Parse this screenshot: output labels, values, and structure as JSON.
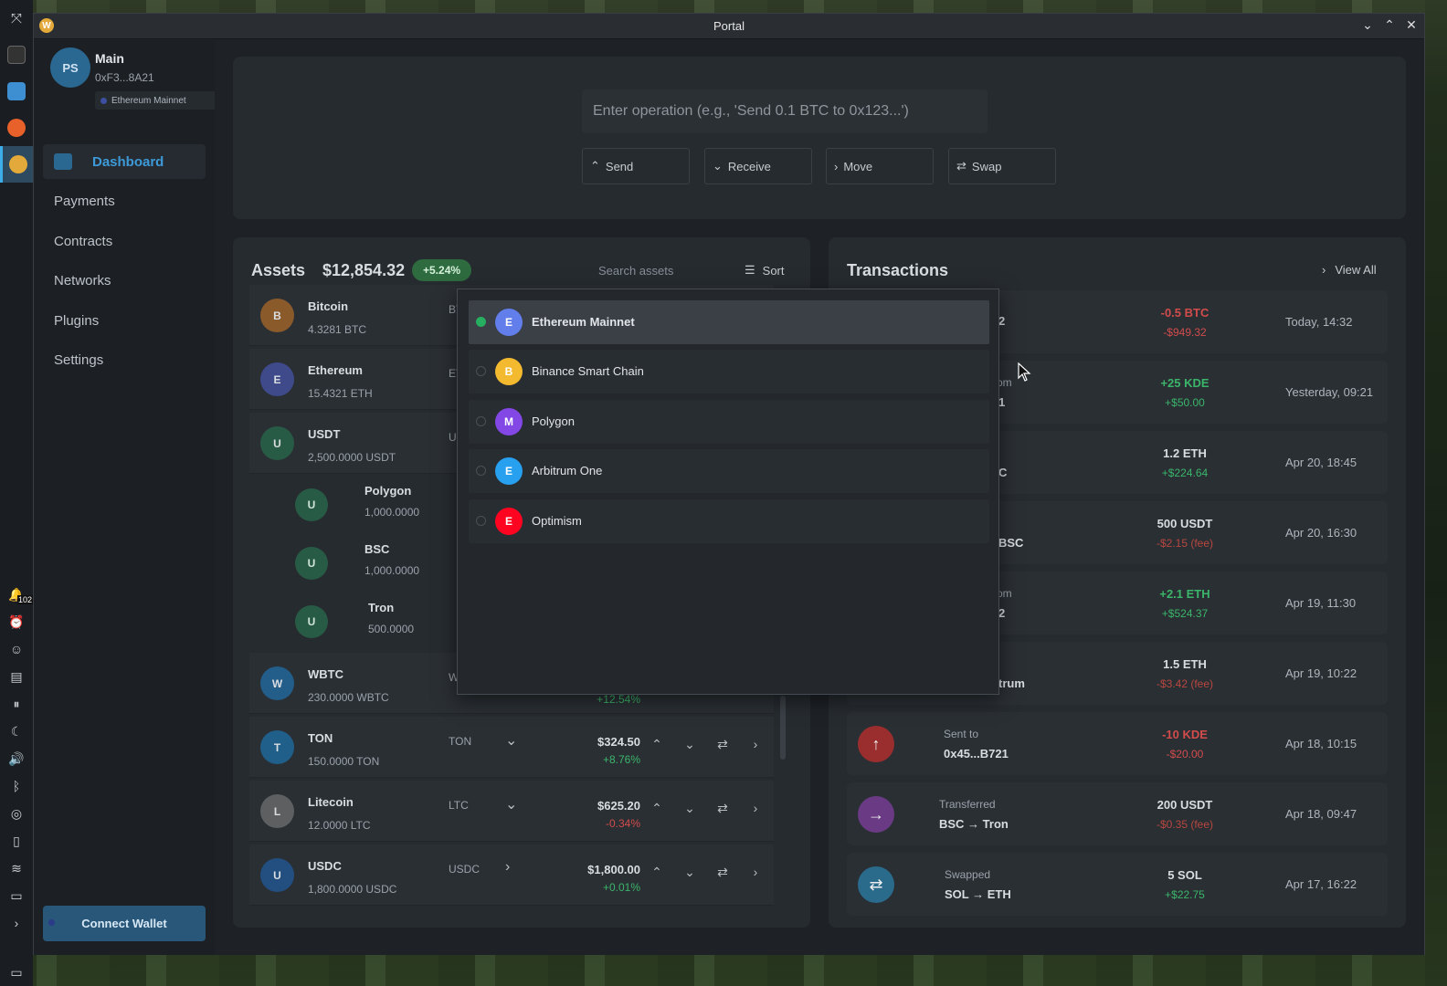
{
  "window": {
    "title": "Portal"
  },
  "profile": {
    "initials": "PS",
    "name": "Main",
    "address": "0xF3...8A21",
    "network": "Ethereum Mainnet"
  },
  "nav": {
    "items": [
      {
        "label": "Dashboard",
        "active": true
      },
      {
        "label": "Payments"
      },
      {
        "label": "Contracts"
      },
      {
        "label": "Networks"
      },
      {
        "label": "Plugins"
      },
      {
        "label": "Settings"
      }
    ]
  },
  "connect": {
    "label": "Connect Wallet"
  },
  "operation": {
    "placeholder": "Enter operation (e.g., 'Send 0.1 BTC to 0x123...')"
  },
  "actions": {
    "send": "Send",
    "receive": "Receive",
    "move": "Move",
    "swap": "Swap"
  },
  "assets": {
    "title": "Assets",
    "total": "$12,854.32",
    "change": "+5.24%",
    "search_placeholder": "Search assets",
    "sort_label": "Sort",
    "rows": [
      {
        "initial": "B",
        "name": "Bitcoin",
        "amount": "4.3281 BTC",
        "symbol": "BT",
        "color": "#8a5a2b"
      },
      {
        "initial": "E",
        "name": "Ethereum",
        "amount": "15.4321 ETH",
        "symbol": "ET",
        "color": "#3e4a8a"
      },
      {
        "initial": "U",
        "name": "USDT",
        "amount": "2,500.0000 USDT",
        "symbol": "U",
        "color": "#285b45"
      },
      {
        "initial": "W",
        "name": "WBTC",
        "amount": "230.0000 WBTC",
        "symbol": "W",
        "color": "#235d8a",
        "change": "+12.54%"
      },
      {
        "initial": "T",
        "name": "TON",
        "amount": "150.0000 TON",
        "symbol": "TON",
        "price": "$324.50",
        "change": "+8.76%",
        "color": "#1f5f8a"
      },
      {
        "initial": "L",
        "name": "Litecoin",
        "amount": "12.0000 LTC",
        "symbol": "LTC",
        "price": "$625.20",
        "change": "-0.34%",
        "color": "#5d5f61"
      },
      {
        "initial": "U",
        "name": "USDC",
        "amount": "1,800.0000 USDC",
        "symbol": "USDC",
        "price": "$1,800.00",
        "change": "+0.01%",
        "color": "#234e80"
      }
    ],
    "sub_rows": [
      {
        "initial": "U",
        "name": "Polygon",
        "amount": "1,000.0000"
      },
      {
        "initial": "U",
        "name": "BSC",
        "amount": "1,000.0000"
      },
      {
        "initial": "U",
        "name": "Tron",
        "amount": "500.0000"
      }
    ]
  },
  "transactions": {
    "title": "Transactions",
    "view_all": "View All",
    "items": [
      {
        "label": "",
        "who": "2",
        "amount": "-0.5 BTC",
        "usd": "-$949.32",
        "time": "Today, 14:32",
        "amount_tone": "neg",
        "usd_tone": "neg"
      },
      {
        "label": "om",
        "who": "1",
        "amount": "+25 KDE",
        "usd": "+$50.00",
        "time": "Yesterday, 09:21",
        "amount_tone": "pos",
        "usd_tone": "pos"
      },
      {
        "label": "",
        "who": "C",
        "amount": "1.2 ETH",
        "usd": "+$224.64",
        "time": "Apr 20, 18:45",
        "amount_tone": "neu",
        "usd_tone": "pos"
      },
      {
        "label": "",
        "who": "BSC",
        "amount": "500 USDT",
        "usd": "-$2.15 (fee)",
        "time": "Apr 20, 16:30",
        "amount_tone": "neu",
        "usd_tone": "neg"
      },
      {
        "label": "om",
        "who": "2",
        "amount": "+2.1 ETH",
        "usd": "+$524.37",
        "time": "Apr 19, 11:30",
        "amount_tone": "pos",
        "usd_tone": "pos"
      },
      {
        "label": "",
        "who": "trum",
        "amount": "1.5 ETH",
        "usd": "-$3.42 (fee)",
        "time": "Apr 19, 10:22",
        "amount_tone": "neu",
        "usd_tone": "neg"
      },
      {
        "label": "Sent to",
        "who": "0x45...B721",
        "amount": "-10 KDE",
        "usd": "-$20.00",
        "time": "Apr 18, 10:15",
        "amount_tone": "neg",
        "usd_tone": "neg",
        "icon": "↑",
        "icon_name": "arrow-up-icon",
        "icon_color": "#9a2e2e"
      },
      {
        "label": "Transferred",
        "who": "BSC → Tron",
        "amount": "200 USDT",
        "usd": "-$0.35 (fee)",
        "time": "Apr 18, 09:47",
        "amount_tone": "neu",
        "usd_tone": "neg",
        "icon": "→",
        "icon_name": "arrow-right-icon",
        "icon_color": "#6b3a84"
      },
      {
        "label": "Swapped",
        "who": "SOL → ETH",
        "amount": "5 SOL",
        "usd": "+$22.75",
        "time": "Apr 17, 16:22",
        "amount_tone": "neu",
        "usd_tone": "pos",
        "icon": "⇄",
        "icon_name": "swap-icon",
        "icon_color": "#2a6b8c"
      }
    ]
  },
  "network_dropdown": {
    "options": [
      {
        "initial": "E",
        "label": "Ethereum Mainnet",
        "selected": true,
        "color": "#627eea"
      },
      {
        "initial": "B",
        "label": "Binance Smart Chain",
        "color": "#f3ba2f"
      },
      {
        "initial": "M",
        "label": "Polygon",
        "color": "#8247e5"
      },
      {
        "initial": "E",
        "label": "Arbitrum One",
        "color": "#28a0f0"
      },
      {
        "initial": "E",
        "label": "Optimism",
        "color": "#ff0420"
      }
    ]
  },
  "tray": {
    "notification_count": "102"
  }
}
